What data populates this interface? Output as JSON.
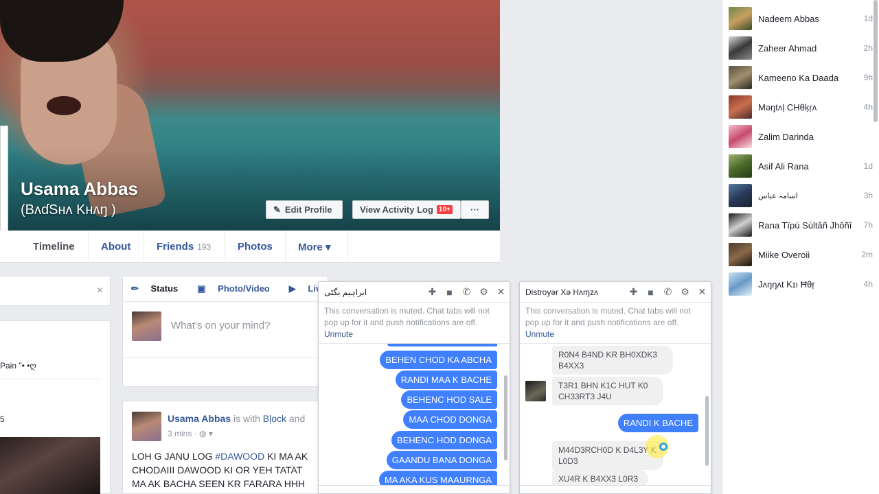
{
  "profile": {
    "name": "Usama Abbas",
    "alt_name": "(BʌɗSнʌ Kнʌŋ )",
    "edit_profile": "Edit Profile",
    "view_activity": "View Activity Log",
    "activity_badge": "10+",
    "more_dots": "···"
  },
  "nav": {
    "timeline": "Timeline",
    "about": "About",
    "friends": "Friends",
    "friends_count": "193",
    "photos": "Photos",
    "more": "More ▾"
  },
  "left": {
    "close": "×",
    "snippet1": "Pain \"• •ღ",
    "snippet2": "5"
  },
  "composer": {
    "status": "Status",
    "photo_video": "Photo/Video",
    "live_video": "Live video",
    "placeholder": "What's on your mind?"
  },
  "post": {
    "author": "Usama Abbas",
    "with_text": "is with",
    "tagged": "Bļock",
    "and_text": "and",
    "time": "3 mins",
    "line1_a": "LOH G JANU LOG ",
    "hashtag": "#DAWOOD",
    "line1_b": " KI MA AK",
    "line2": "CHODAIII DAWOOD KI OR YEH TATAT",
    "line3": "MA AK BACHA SEEN KR FARARA HHH"
  },
  "chat1": {
    "title": "ابراہیم بگٹی",
    "muted_text": "This conversation is muted. Chat tabs will not pop up for it and push notifications are off.",
    "unmute": "Unmute",
    "messages": [
      "BEHEN CHOD KA ABCHA",
      "RANDI MAA K BACHE",
      "BEHENC HOD SALE",
      "MAA CHOD DONGA",
      "BEHENC HOD DONGA",
      "GAANDU BANA DONGA",
      "MA AKA KUS MAAURNGA"
    ]
  },
  "chat2": {
    "title": "Distroyər Xə Hʌɱzʌ",
    "muted_text": "This conversation is muted. Chat tabs will not pop up for it and push notifications are off.",
    "unmute": "Unmute",
    "in1": "R0N4 B4ND KR BH0XDK3 B4XX3",
    "in2": "T3R1 BHN K1C HUT K0 CH33RT3 J4U",
    "out1": "RANDI K BACHE",
    "in3": "M44D3RCH0D K D4L3Y K L0D3",
    "in4": "XU4R K B4XX3 L0R3"
  },
  "contacts": [
    {
      "name": "Nadeem Abbas",
      "time": "1d",
      "color": "#6a8a4a"
    },
    {
      "name": "Zaheer Ahmad",
      "time": "2h",
      "color": "#3a3a3a"
    },
    {
      "name": "Kameeno Ka Daada",
      "time": "9h",
      "color": "#5a5040"
    },
    {
      "name": "Məŋtʌļ CНθķŗʌ",
      "time": "4h",
      "color": "#8a3a2a"
    },
    {
      "name": "Zalim Darinda",
      "time": "",
      "color": "#c84a6a"
    },
    {
      "name": "Asif Ali Rana",
      "time": "1d",
      "color": "#4a6a2a"
    },
    {
      "name": "اسامہ عباس",
      "time": "3h",
      "color": "#2a3a5a"
    },
    {
      "name": "Rana Tïpú Sùltâñ Jhôñî",
      "time": "7h",
      "color": "#1a1a1a"
    },
    {
      "name": "Miike Overoii",
      "time": "2m",
      "color": "#4a3a2a"
    },
    {
      "name": "Jʌŋŋʌt Kɪı Ħθŗ",
      "time": "4h",
      "color": "#6a9ac8"
    }
  ]
}
